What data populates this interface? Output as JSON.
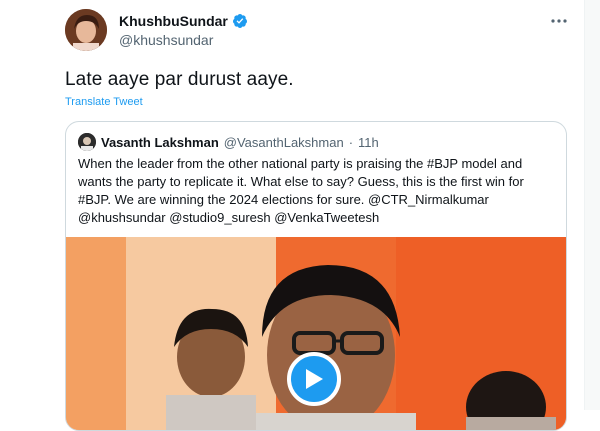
{
  "author": {
    "display_name": "KhushbuSundar",
    "handle": "@khushsundar",
    "avatar_icon": "profile-photo"
  },
  "tweet": {
    "text": "Late aaye par durust aaye.",
    "translate_label": "Translate Tweet"
  },
  "quoted_tweet": {
    "display_name": "Vasanth Lakshman",
    "handle": "@VasanthLakshman",
    "separator": "·",
    "time": "11h",
    "text_lines": [
      "When the leader from the other national party is praising the #BJP model and",
      "wants the party to replicate it. What else to say? Guess, this is the first win for",
      "#BJP. We are winning the 2024 elections for sure. @CTR_Nirmalkumar",
      "@khushsundar @studio9_suresh @VenkaTweetesh"
    ]
  },
  "colors": {
    "accent": "#1d9bf0",
    "text_primary": "#0f1419",
    "text_secondary": "#536471",
    "border": "#cfd9de",
    "video_backdrop": "#ef6a2f"
  }
}
